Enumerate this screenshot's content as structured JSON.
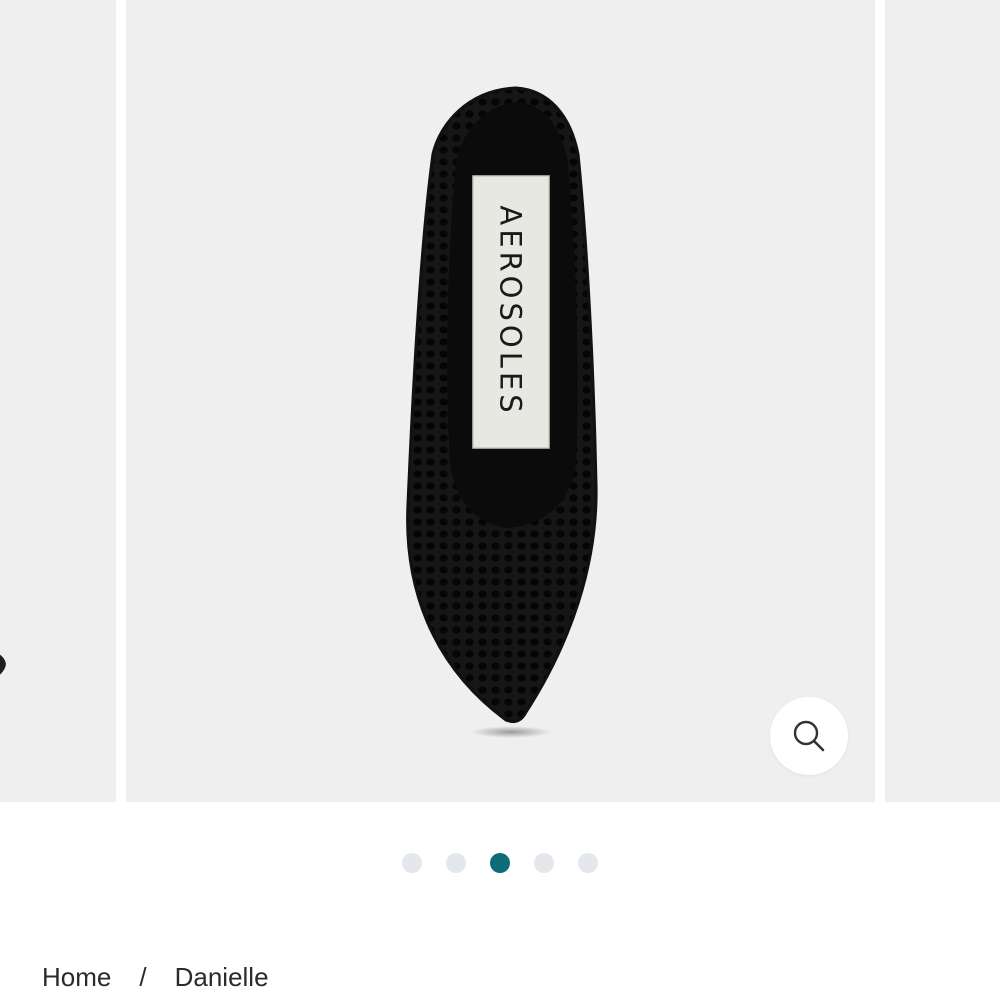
{
  "product": {
    "label_text": "AEROSOLES",
    "gallery_slides": 5,
    "active_slide": 3
  },
  "icons": {
    "zoom": "search-icon"
  },
  "colors": {
    "gallery_bg": "#efefef",
    "dot_active": "#0e6b78",
    "dot_inactive": "#e4e8ec"
  },
  "breadcrumb": {
    "home": "Home",
    "separator": "/",
    "current": "Danielle"
  }
}
